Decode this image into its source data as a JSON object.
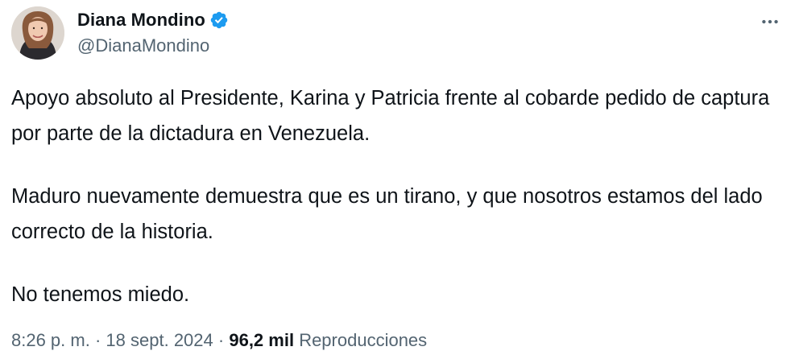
{
  "author": {
    "display_name": "Diana Mondino",
    "handle": "@DianaMondino",
    "verified_icon": "verified-badge-icon",
    "verified_color": "#1d9bf0"
  },
  "menu": {
    "icon": "more-horizontal-icon"
  },
  "tweet": {
    "paragraphs": [
      "Apoyo absoluto al Presidente, Karina y Patricia frente al cobarde pedido de captura por parte de la dictadura en Venezuela.",
      "Maduro nuevamente demuestra que es un tirano, y que nosotros estamos del lado correcto de la historia.",
      "No tenemos miedo."
    ]
  },
  "meta": {
    "time": "8:26 p. m.",
    "separator": "·",
    "date": "18 sept. 2024",
    "views_count": "96,2 mil",
    "views_label": "Reproducciones"
  },
  "colors": {
    "text_primary": "#0f1419",
    "text_secondary": "#536471",
    "accent": "#1d9bf0"
  }
}
